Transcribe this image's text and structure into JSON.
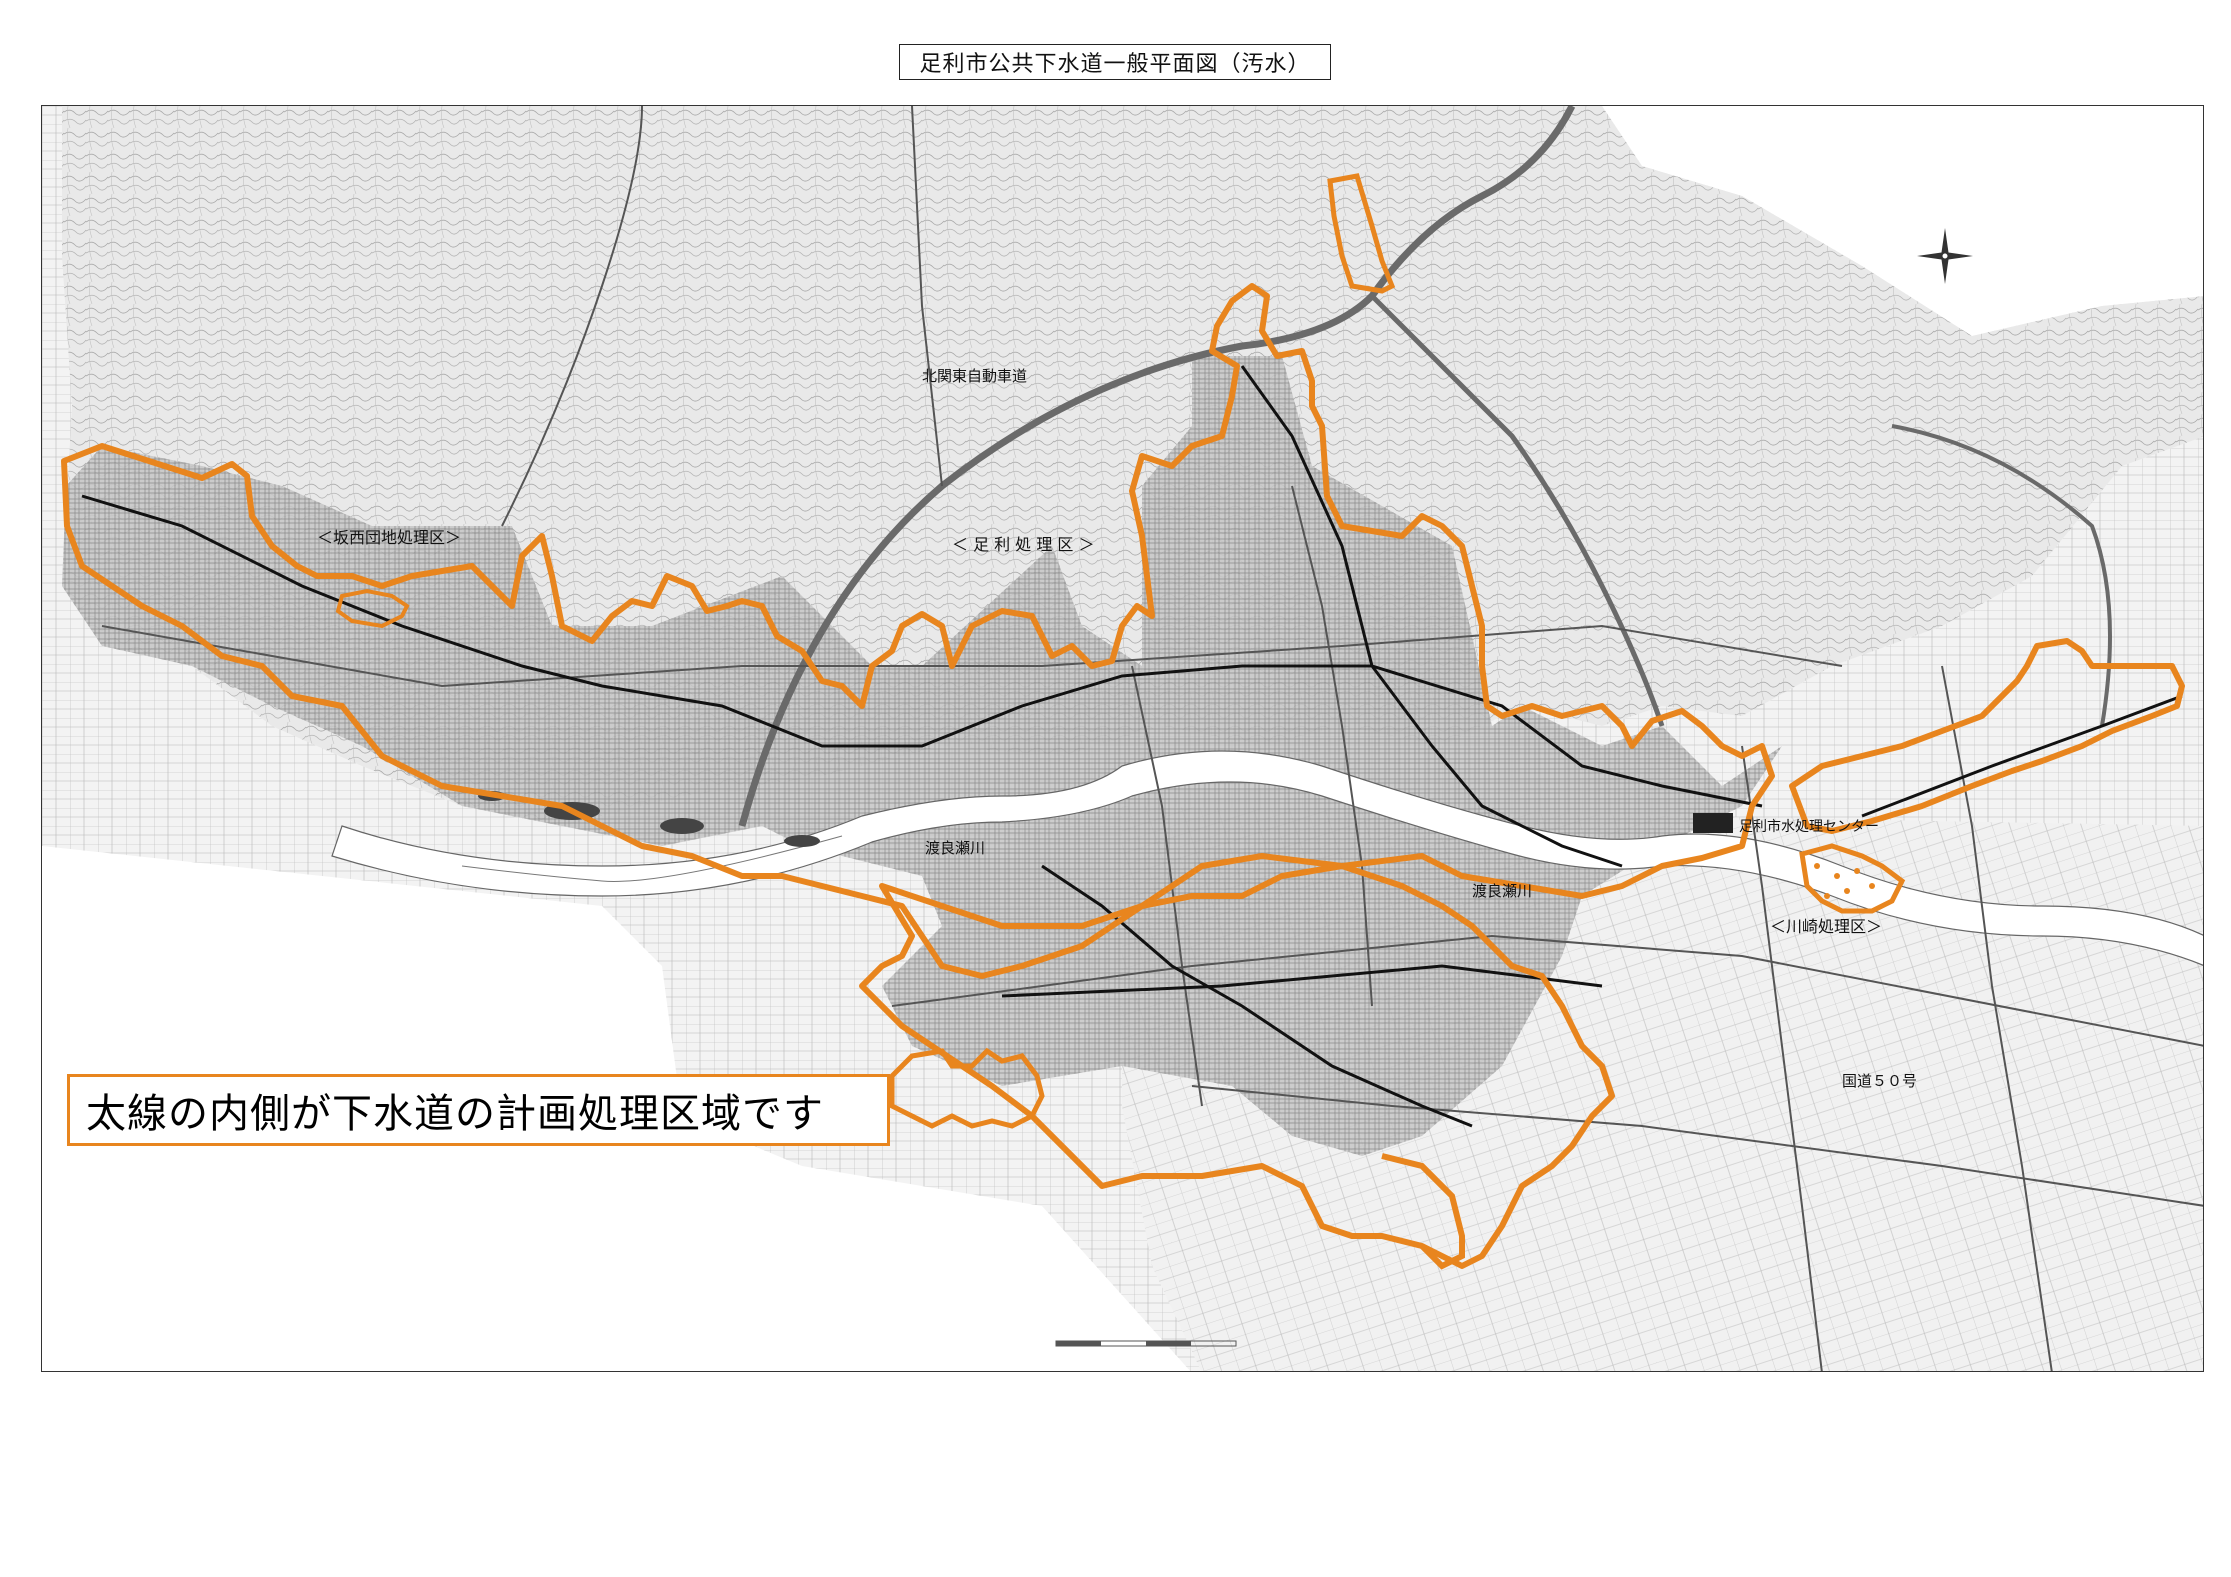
{
  "title": "足利市公共下水道一般平面図（汚水）",
  "legend_note": "太線の内側が下水道の計画処理区域です",
  "map": {
    "labels": {
      "expressway": "北関東自動車道",
      "sakanishi_district": "＜坂西団地処理区＞",
      "ashikaga_district": "＜ 足 利 処 理 区 ＞",
      "river_west": "渡良瀬川",
      "river_east": "渡良瀬川",
      "treatment_center": "足利市水処理センター",
      "kawasaki_district": "＜川崎処理区＞",
      "route50": "国道５０号"
    },
    "colors": {
      "boundary": "#E8851E",
      "terrain_line": "#8a8a8a",
      "road": "#555555",
      "sewer_main": "#111111",
      "river": "#ffffff"
    }
  }
}
